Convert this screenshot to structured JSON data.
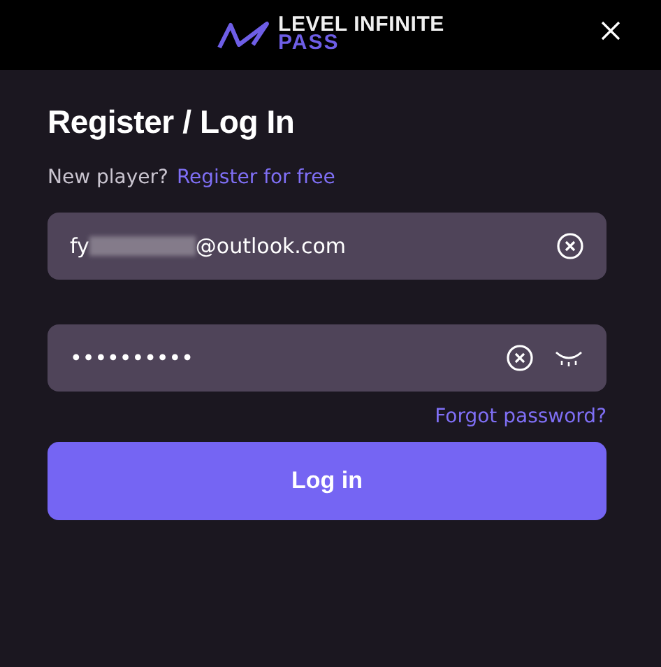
{
  "header": {
    "logo_line_1": "LEVEL INFINITE",
    "logo_line_2": "PASS"
  },
  "title": "Register / Log In",
  "signup": {
    "prompt": "New player?",
    "link": "Register for free"
  },
  "email_field": {
    "value_start": "fy",
    "value_end": "@outlook.com",
    "redacted": true
  },
  "password_field": {
    "value": "••••••••••"
  },
  "forgot_link": "Forgot password?",
  "login_button": "Log in"
}
